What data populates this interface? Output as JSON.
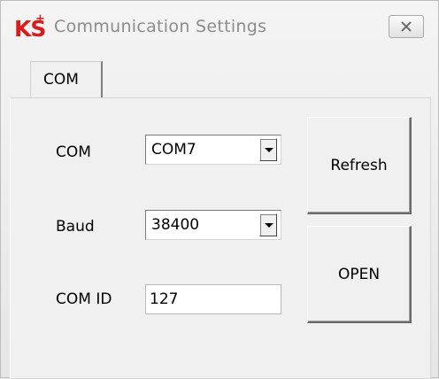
{
  "window": {
    "title": "Communication Settings",
    "logo_text": "KS",
    "logo_plus": "+"
  },
  "tabs": [
    {
      "label": "COM"
    }
  ],
  "form": {
    "com_label": "COM",
    "com_value": "COM7",
    "baud_label": "Baud",
    "baud_value": "38400",
    "comid_label": "COM ID",
    "comid_value": "127"
  },
  "buttons": {
    "refresh": "Refresh",
    "open": "OPEN"
  },
  "colors": {
    "logo": "#d91d1d",
    "title_text": "#8c8c8c",
    "background": "#f0f0f0"
  },
  "icons": {
    "close": "close-icon",
    "dropdown": "chevron-down-icon"
  }
}
